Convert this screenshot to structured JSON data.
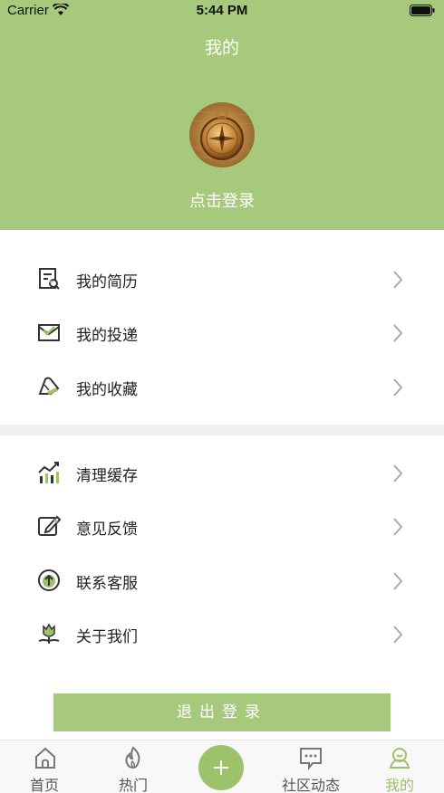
{
  "status_bar": {
    "carrier": "Carrier",
    "time": "5:44 PM",
    "wifi_icon": "wifi-icon",
    "battery_icon": "battery-icon"
  },
  "header": {
    "title": "我的",
    "avatar_icon": "compass-avatar",
    "login_label": "点击登录",
    "background_color": "#a7c97c"
  },
  "menu": {
    "group1": [
      {
        "label": "我的简历",
        "icon": "resume-search-icon"
      },
      {
        "label": "我的投递",
        "icon": "envelope-check-icon"
      },
      {
        "label": "我的收藏",
        "icon": "bookmark-icon"
      }
    ],
    "group2": [
      {
        "label": "清理缓存",
        "icon": "chart-bars-icon"
      },
      {
        "label": "意见反馈",
        "icon": "edit-icon"
      },
      {
        "label": "联系客服",
        "icon": "upload-circle-icon"
      },
      {
        "label": "关于我们",
        "icon": "flower-icon"
      }
    ],
    "chevron_icon": "chevron-right-icon"
  },
  "logout": {
    "label": "退出登录"
  },
  "tabbar": {
    "items": [
      {
        "label": "首页",
        "icon": "home-icon",
        "active": false
      },
      {
        "label": "热门",
        "icon": "flame-icon",
        "active": false
      },
      {
        "label": "",
        "icon": "plus-icon",
        "active": false
      },
      {
        "label": "社区动态",
        "icon": "chat-icon",
        "active": false
      },
      {
        "label": "我的",
        "icon": "profile-icon",
        "active": true
      }
    ],
    "accent_color": "#9cc26c"
  }
}
